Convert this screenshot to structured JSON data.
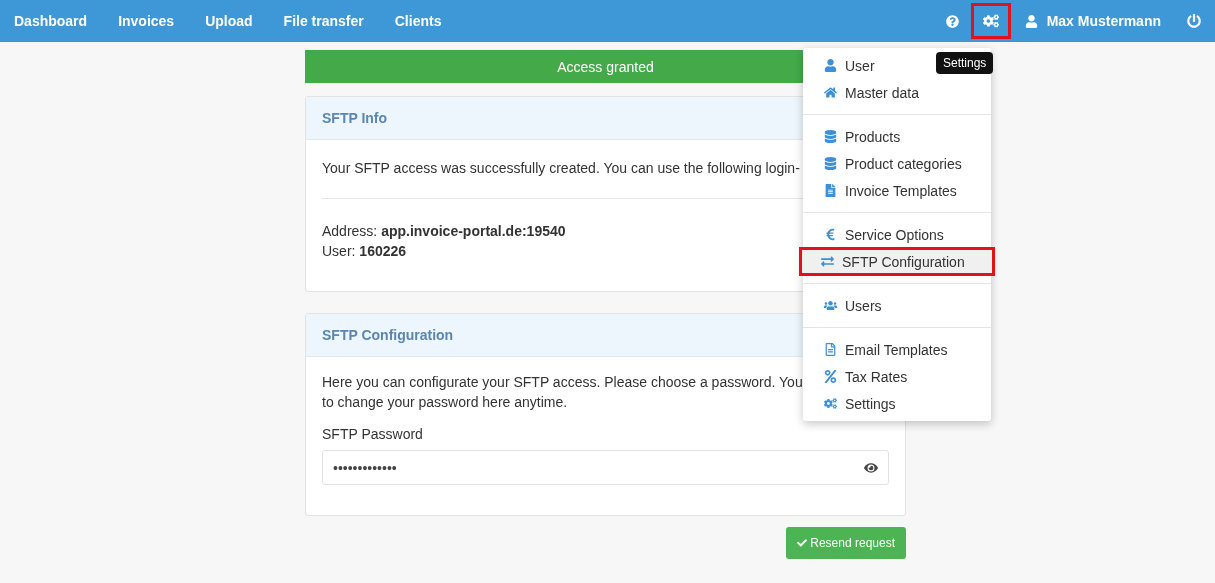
{
  "navbar": {
    "links": [
      {
        "label": "Dashboard"
      },
      {
        "label": "Invoices"
      },
      {
        "label": "Upload"
      },
      {
        "label": "File transfer"
      },
      {
        "label": "Clients"
      }
    ],
    "settings": {
      "highlighted": true,
      "tooltip": "Settings"
    },
    "user": {
      "name": "Max Mustermann"
    }
  },
  "alert": {
    "text": "Access granted"
  },
  "info_card": {
    "title": "SFTP Info",
    "text": "Your SFTP access was successfully created. You can use the following login-",
    "address_label": "Address:",
    "address": "app.invoice-portal.de:19540",
    "user_label": "User:",
    "user": "160226"
  },
  "config_card": {
    "title": "SFTP Configuration",
    "lines": [
      "Here you can configurate your SFTP access. Please choose a password. You",
      "to change your password here anytime."
    ],
    "password_label": "SFTP Password",
    "password": "•••••••••••••"
  },
  "resend_button": {
    "label": "Resend request"
  },
  "settings_menu": {
    "groups": [
      {
        "items": [
          {
            "label": "User",
            "selected": false,
            "highlighted": false
          },
          {
            "label": "Master data",
            "selected": false,
            "highlighted": false
          }
        ]
      },
      {
        "items": [
          {
            "label": "Products",
            "selected": false,
            "highlighted": false
          },
          {
            "label": "Product categories",
            "selected": false,
            "highlighted": false
          },
          {
            "label": "Invoice Templates",
            "selected": false,
            "highlighted": false
          }
        ]
      },
      {
        "items": [
          {
            "label": "Service Options",
            "selected": false,
            "highlighted": false
          },
          {
            "label": "SFTP Configuration",
            "selected": true,
            "highlighted": true
          }
        ]
      },
      {
        "items": [
          {
            "label": "Users",
            "selected": false,
            "highlighted": false
          }
        ]
      },
      {
        "items": [
          {
            "label": "Email Templates",
            "selected": false,
            "highlighted": false
          },
          {
            "label": "Tax Rates",
            "selected": false,
            "highlighted": false
          },
          {
            "label": "Settings",
            "selected": false,
            "highlighted": false
          }
        ]
      }
    ]
  }
}
